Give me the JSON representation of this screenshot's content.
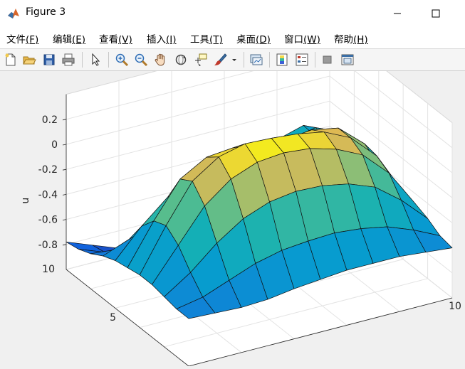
{
  "window": {
    "title": "Figure 3"
  },
  "menu": [
    {
      "label": "文件",
      "key": "(F)"
    },
    {
      "label": "编辑",
      "key": "(E)"
    },
    {
      "label": "查看",
      "key": "(V)"
    },
    {
      "label": "插入",
      "key": "(I)"
    },
    {
      "label": "工具",
      "key": "(T)"
    },
    {
      "label": "桌面",
      "key": "(D)"
    },
    {
      "label": "窗口",
      "key": "(W)"
    },
    {
      "label": "帮助",
      "key": "(H)"
    }
  ],
  "toolbar": [
    {
      "icon": "new-figure-icon"
    },
    {
      "icon": "open-file-icon"
    },
    {
      "icon": "save-icon"
    },
    {
      "icon": "print-icon"
    },
    {
      "icon": "edit-plot-arrow-icon"
    },
    {
      "icon": "zoom-in-icon"
    },
    {
      "icon": "zoom-out-icon"
    },
    {
      "icon": "pan-hand-icon"
    },
    {
      "icon": "rotate-3d-icon"
    },
    {
      "icon": "data-cursor-icon"
    },
    {
      "icon": "brush-icon"
    },
    {
      "icon": "brush-dropdown-icon"
    },
    {
      "icon": "link-plot-icon"
    },
    {
      "icon": "colorbar-icon"
    },
    {
      "icon": "legend-icon"
    },
    {
      "icon": "hide-plot-tools-icon"
    },
    {
      "icon": "show-plot-tools-icon"
    }
  ],
  "chart_data": {
    "type": "surface",
    "zlabel": "u",
    "z_ticks": [
      "0.2",
      "0",
      "-0.2",
      "-0.4",
      "-0.6",
      "-0.8"
    ],
    "z_tick_values": [
      0.2,
      0,
      -0.2,
      -0.4,
      -0.6,
      -0.8
    ],
    "y_ticks_visible": [
      "10",
      "5"
    ],
    "x_ticks_visible": [
      "10"
    ],
    "zlim": [
      -1.0,
      0.4
    ],
    "grid": true,
    "colormap": "parula",
    "grid_size": [
      11,
      11
    ],
    "z_values": [
      [
        -0.62,
        -0.63,
        -0.64,
        -0.63,
        -0.6,
        -0.58,
        -0.56,
        -0.56,
        -0.56,
        -0.58,
        -0.6
      ],
      [
        -0.62,
        -0.58,
        -0.5,
        -0.42,
        -0.37,
        -0.35,
        -0.34,
        -0.36,
        -0.4,
        -0.48,
        -0.58
      ],
      [
        -0.6,
        -0.46,
        -0.28,
        -0.14,
        -0.06,
        -0.03,
        -0.04,
        -0.08,
        -0.16,
        -0.32,
        -0.52
      ],
      [
        -0.58,
        -0.32,
        -0.06,
        0.1,
        0.18,
        0.2,
        0.18,
        0.12,
        0.02,
        -0.18,
        -0.48
      ],
      [
        -0.58,
        -0.24,
        0.06,
        0.2,
        0.25,
        0.24,
        0.22,
        0.18,
        0.08,
        -0.12,
        -0.46
      ],
      [
        -0.6,
        -0.28,
        0.0,
        0.12,
        0.14,
        0.12,
        0.1,
        0.12,
        0.08,
        -0.1,
        -0.46
      ],
      [
        -0.62,
        -0.4,
        -0.22,
        -0.18,
        -0.22,
        -0.26,
        -0.2,
        -0.12,
        -0.06,
        -0.14,
        -0.48
      ],
      [
        -0.66,
        -0.58,
        -0.52,
        -0.56,
        -0.62,
        -0.62,
        -0.48,
        -0.3,
        -0.16,
        -0.18,
        -0.5
      ],
      [
        -0.72,
        -0.74,
        -0.8,
        -0.86,
        -0.92,
        -0.88,
        -0.68,
        -0.42,
        -0.24,
        -0.22,
        -0.52
      ],
      [
        -0.76,
        -0.84,
        -0.92,
        -0.98,
        -1.02,
        -0.98,
        -0.78,
        -0.52,
        -0.32,
        -0.28,
        -0.56
      ],
      [
        -0.78,
        -0.86,
        -0.94,
        -1.0,
        -1.04,
        -1.02,
        -0.84,
        -0.6,
        -0.4,
        -0.34,
        -0.58
      ]
    ]
  }
}
